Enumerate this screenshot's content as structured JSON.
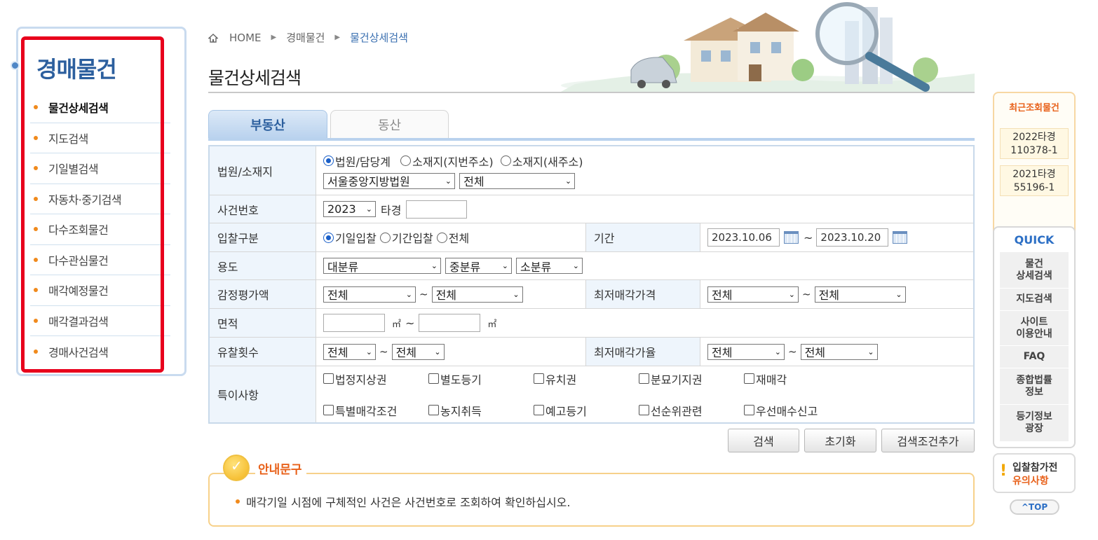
{
  "sidebar": {
    "title": "경매물건",
    "items": [
      {
        "label": "물건상세검색",
        "active": true
      },
      {
        "label": "지도검색"
      },
      {
        "label": "기일별검색"
      },
      {
        "label": "자동차·중기검색"
      },
      {
        "label": "다수조회물건"
      },
      {
        "label": "다수관심물건"
      },
      {
        "label": "매각예정물건"
      },
      {
        "label": "매각결과검색"
      },
      {
        "label": "경매사건검색"
      }
    ]
  },
  "breadcrumb": {
    "home": "HOME",
    "level1": "경매물건",
    "current": "물건상세검색"
  },
  "page_title": "물건상세검색",
  "tabs": {
    "realestate": "부동산",
    "movable": "동산"
  },
  "form": {
    "court": {
      "label": "법원/소재지",
      "radio1": "법원/담당계",
      "radio2": "소재지(지번주소)",
      "radio3": "소재지(새주소)",
      "court_select": "서울중앙지방법원",
      "dept_select": "전체"
    },
    "case_no": {
      "label": "사건번호",
      "year": "2023",
      "suffix": "타경"
    },
    "bid_type": {
      "label": "입찰구분",
      "radio1": "기일입찰",
      "radio2": "기간입찰",
      "radio3": "전체",
      "period_label": "기간",
      "date_from": "2023.10.06",
      "date_to": "2023.10.20",
      "tilde": "~"
    },
    "usage": {
      "label": "용도",
      "major": "대분류",
      "middle": "중분류",
      "minor": "소분류"
    },
    "appraisal": {
      "label": "감정평가액",
      "from": "전체",
      "to": "전체",
      "min_label": "최저매각가격",
      "min_from": "전체",
      "min_to": "전체"
    },
    "area": {
      "label": "면적",
      "unit": "㎡",
      "tilde": "~"
    },
    "failed": {
      "label": "유찰횟수",
      "from": "전체",
      "to": "전체",
      "rate_label": "최저매각가율",
      "rate_from": "전체",
      "rate_to": "전체"
    },
    "special": {
      "label": "특이사항",
      "row1": [
        "법정지상권",
        "별도등기",
        "유치권",
        "분묘기지권",
        "재매각"
      ],
      "row2": [
        "특별매각조건",
        "농지취득",
        "예고등기",
        "선순위관련",
        "우선매수신고"
      ]
    }
  },
  "buttons": {
    "search": "검색",
    "reset": "초기화",
    "add_condition": "검색조건추가"
  },
  "notice": {
    "title": "안내문구",
    "text": "매각기일 시점에 구체적인 사건은 사건번호로 조회하여 확인하십시오."
  },
  "recent": {
    "title": "최근조회물건",
    "item1_l1": "2022타경",
    "item1_l2": "110378-1",
    "item2_l1": "2021타경",
    "item2_l2": "55196-1"
  },
  "quick": {
    "title": "QUICK",
    "item1_l1": "물건",
    "item1_l2": "상세검색",
    "item2": "지도검색",
    "item3_l1": "사이트",
    "item3_l2": "이용안내",
    "item4": "FAQ",
    "item5_l1": "종합법률",
    "item5_l2": "정보",
    "item6_l1": "등기정보",
    "item6_l2": "광장"
  },
  "caution": {
    "mark": "!",
    "line1": "입찰참가전",
    "line2": "유의사항"
  },
  "top_button": "^TOP",
  "colors": {
    "brand_blue": "#2c5f9e",
    "accent_orange": "#e8611a",
    "highlight_red": "#e8001c"
  }
}
